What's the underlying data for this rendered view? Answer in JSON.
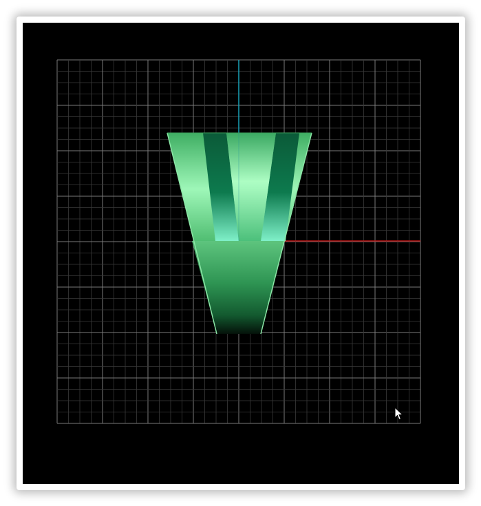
{
  "viewport": {
    "background_color": "#000000"
  },
  "grid": {
    "major_divisions": 8,
    "minor_per_major": 4,
    "minor_line_color": "#3a3a3a",
    "major_line_color": "#7a7a7a"
  },
  "axes": {
    "vertical_axis_color": "#19a3b8",
    "horizontal_axis_color": "#c01616"
  },
  "model": {
    "name": "green-beveled-trapezoid-with-notches",
    "body_color_light": "#9ef7b8",
    "body_color_mid": "#3fae63",
    "body_color_dark": "#0a3a1e",
    "notch_color_light": "#7ff0c8",
    "notch_color_dark": "#0b6a44"
  },
  "cursor": {
    "icon": "arrow-pointer-icon",
    "fill_color": "#ffffff",
    "stroke_color": "#000000"
  }
}
